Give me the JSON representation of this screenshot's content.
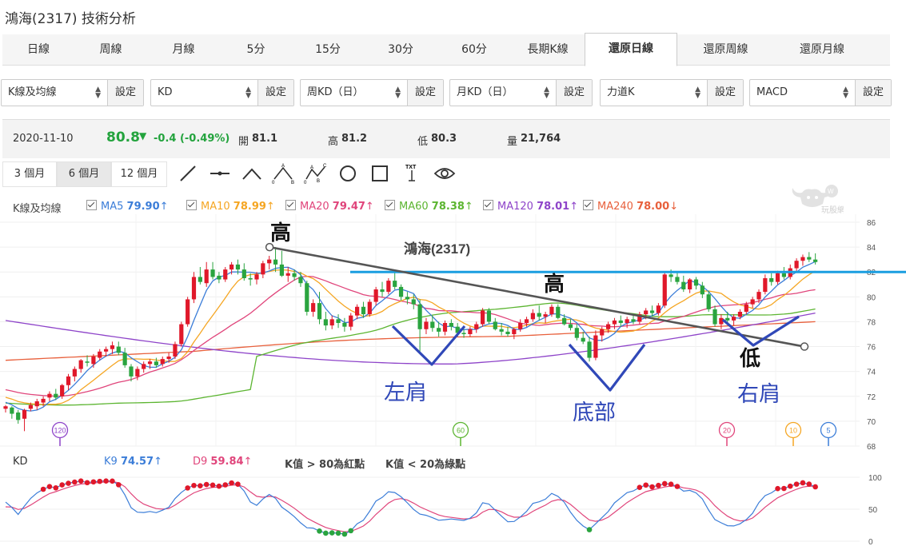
{
  "page": {
    "title": "鴻海(2317) 技術分析"
  },
  "tabs": [
    "日線",
    "周線",
    "月線",
    "5分",
    "15分",
    "30分",
    "60分",
    "長期K線",
    "還原日線",
    "還原周線",
    "還原月線"
  ],
  "active_tab": "還原日線",
  "selectors": [
    {
      "value": "K線及均線",
      "button": "設定"
    },
    {
      "value": "KD",
      "button": "設定"
    },
    {
      "value": "周KD（日）",
      "button": "設定"
    },
    {
      "value": "月KD（日）",
      "button": "設定"
    },
    {
      "value": "力道K",
      "button": "設定"
    },
    {
      "value": "MACD",
      "button": "設定"
    }
  ],
  "quote": {
    "date": "2020-11-10",
    "price": "80.8",
    "change": "-0.4 (-0.49%)",
    "open_label": "開",
    "open": "81.1",
    "high_label": "高",
    "high": "81.2",
    "low_label": "低",
    "low": "80.3",
    "volume_label": "量",
    "volume": "21,764"
  },
  "ranges": [
    "3 個月",
    "6 個月",
    "12 個月"
  ],
  "active_range": "6 個月",
  "tools": [
    "line-tool-icon",
    "horizontal-line-tool-icon",
    "angle-tool-icon",
    "abc-pattern-tool-icon",
    "abcd-pattern-tool-icon",
    "circle-tool-icon",
    "rectangle-tool-icon",
    "text-tool-icon",
    "eye-icon"
  ],
  "tool_text": {
    "abc_a": "A",
    "abc_b": "B",
    "abc_c": "C",
    "abc_o": "0",
    "abcd_a": "A",
    "abcd_b": "B",
    "abcd_c": "C",
    "abcd_d": "D",
    "abcd_o": "0",
    "txt": "TXT"
  },
  "ma_legend": {
    "title": "K線及均線",
    "items": [
      {
        "label": "MA5",
        "value": "79.90",
        "arrow": "↑",
        "color": "#3b7dd8"
      },
      {
        "label": "MA10",
        "value": "78.99",
        "arrow": "↑",
        "color": "#f5a623"
      },
      {
        "label": "MA20",
        "value": "79.47",
        "arrow": "↑",
        "color": "#e0457b"
      },
      {
        "label": "MA60",
        "value": "78.38",
        "arrow": "↑",
        "color": "#5cb531"
      },
      {
        "label": "MA120",
        "value": "78.01",
        "arrow": "↑",
        "color": "#8e44c9"
      },
      {
        "label": "MA240",
        "value": "78.00",
        "arrow": "↓",
        "color": "#e8603c"
      }
    ]
  },
  "watermark": "玩股網",
  "kd_legend": {
    "title": "KD",
    "k_label": "K9",
    "k_value": "74.57",
    "k_arrow": "↑",
    "d_label": "D9",
    "d_value": "59.84",
    "d_arrow": "↑",
    "note1": "K值 > 80為紅點",
    "note2": "K值 < 20為綠點"
  },
  "colors": {
    "up": "#e0182a",
    "down": "#2aa43f",
    "ma5": "#3b7dd8",
    "ma10": "#f5a623",
    "ma20": "#e0457b",
    "ma60": "#5cb531",
    "ma120": "#8e44c9",
    "ma240": "#e8603c",
    "annotation": "#3048b8",
    "neckline": "#1a9ee0",
    "trend": "#555555"
  },
  "chart_data": [
    {
      "type": "candlestick",
      "title": "鴻海(2317)",
      "ylim": [
        68,
        86
      ],
      "yticks": [
        "86",
        "84",
        "82",
        "80",
        "78",
        "76",
        "74",
        "72",
        "70",
        "68"
      ],
      "ohlc": [
        [
          71,
          71.3,
          70.7,
          71.2
        ],
        [
          71.1,
          71.2,
          70.2,
          70.6
        ],
        [
          70.7,
          70.9,
          69.8,
          70.1
        ],
        [
          70.2,
          71.0,
          69.2,
          70.9
        ],
        [
          71.0,
          71.5,
          70.8,
          71.3
        ],
        [
          71.2,
          71.8,
          70.9,
          71.6
        ],
        [
          71.5,
          72,
          71.2,
          71.8
        ],
        [
          71.9,
          72.4,
          71.6,
          72.2
        ],
        [
          72.2,
          72.6,
          71.7,
          71.9
        ],
        [
          72,
          73,
          71.8,
          72.9
        ],
        [
          72.9,
          73.8,
          72.5,
          73.6
        ],
        [
          73.6,
          74.4,
          73.2,
          74.2
        ],
        [
          74.2,
          75,
          73.9,
          74.9
        ],
        [
          74.8,
          75.3,
          74.4,
          74.7
        ],
        [
          74.6,
          75.4,
          74.3,
          75.2
        ],
        [
          75.1,
          75.8,
          74.9,
          75.6
        ],
        [
          75.6,
          76,
          75.2,
          75.8
        ],
        [
          75.8,
          76.4,
          75.4,
          76.1
        ],
        [
          76,
          76.4,
          75.3,
          75.5
        ],
        [
          75.5,
          75.9,
          74.3,
          74.5
        ],
        [
          74.4,
          74.6,
          73.2,
          73.6
        ],
        [
          73.6,
          74.4,
          73.3,
          74.2
        ],
        [
          74.2,
          74.8,
          73.9,
          74.6
        ],
        [
          74.6,
          75,
          74.2,
          74.8
        ],
        [
          74.8,
          75.1,
          74.3,
          74.5
        ],
        [
          74.6,
          75.2,
          74.4,
          75
        ],
        [
          75,
          75.5,
          74.7,
          75.2
        ],
        [
          75.2,
          76.4,
          75,
          76.2
        ],
        [
          76.2,
          78,
          76,
          77.8
        ],
        [
          77.8,
          80,
          77.6,
          79.8
        ],
        [
          79.8,
          82,
          79.5,
          81.6
        ],
        [
          81.6,
          82.4,
          81,
          81.2
        ],
        [
          81.1,
          82.8,
          80.8,
          82.2
        ],
        [
          82.2,
          82.8,
          81.4,
          81.6
        ],
        [
          81.7,
          82,
          81.1,
          81.4
        ],
        [
          81.4,
          82.4,
          81.2,
          82.2
        ],
        [
          82.2,
          82.8,
          81.8,
          82.6
        ],
        [
          82.6,
          83,
          81.8,
          82.2
        ],
        [
          82.2,
          82.7,
          81.3,
          81.5
        ],
        [
          81.5,
          81.9,
          80.9,
          81.4
        ],
        [
          81.4,
          82,
          81,
          81.8
        ],
        [
          81.8,
          82.9,
          81.5,
          82.7
        ],
        [
          82.7,
          83.3,
          82.2,
          83
        ],
        [
          83,
          84,
          82,
          82.6
        ],
        [
          82.6,
          83.7,
          81.6,
          81.7
        ],
        [
          81.7,
          82.4,
          81.2,
          81.9
        ],
        [
          81.9,
          82.2,
          81.3,
          81.6
        ],
        [
          81.6,
          82,
          80.8,
          81.1
        ],
        [
          81.1,
          81.3,
          78.5,
          78.8
        ],
        [
          78.8,
          79.8,
          78.4,
          79.5
        ],
        [
          79.5,
          80.4,
          77.8,
          78.2
        ],
        [
          78.2,
          78.8,
          77.3,
          77.7
        ],
        [
          77.7,
          78.5,
          77.4,
          78.2
        ],
        [
          78.2,
          78.6,
          77.5,
          77.9
        ],
        [
          77.9,
          78.3,
          77.2,
          77.6
        ],
        [
          77.6,
          78.7,
          77.3,
          78.5
        ],
        [
          78.5,
          79.4,
          78.2,
          79.2
        ],
        [
          79.2,
          79.6,
          78.3,
          78.6
        ],
        [
          78.6,
          79.8,
          78.4,
          79.6
        ],
        [
          79.6,
          80.8,
          79.3,
          80.6
        ],
        [
          80.6,
          81.2,
          80,
          80.4
        ],
        [
          80.4,
          81.5,
          80.2,
          81.3
        ],
        [
          81.3,
          82.1,
          80.6,
          80.8
        ],
        [
          80.8,
          81,
          79.7,
          80
        ],
        [
          80,
          80.4,
          79.4,
          79.8
        ],
        [
          79.8,
          80.2,
          79,
          79.4
        ],
        [
          79.4,
          79.8,
          75.6,
          77.4
        ],
        [
          77.4,
          78.3,
          77,
          78
        ],
        [
          78,
          78.5,
          77.2,
          77.5
        ],
        [
          77.5,
          78,
          76.8,
          77.2
        ],
        [
          77.2,
          78.1,
          76.9,
          77.9
        ],
        [
          77.9,
          78.2,
          77.3,
          77.6
        ],
        [
          77.6,
          77.9,
          76.8,
          77.1
        ],
        [
          77.1,
          77.4,
          76.7,
          77
        ],
        [
          77,
          77.6,
          76.8,
          77.4
        ],
        [
          77.4,
          78,
          77.1,
          77.8
        ],
        [
          77.8,
          79.1,
          77.6,
          78.9
        ],
        [
          78.9,
          79.1,
          77.8,
          78
        ],
        [
          78,
          78.3,
          77.3,
          77.4
        ],
        [
          77.4,
          77.9,
          76.9,
          77.2
        ],
        [
          77.2,
          77.6,
          76.8,
          77
        ],
        [
          77,
          77.5,
          76.6,
          77.4
        ],
        [
          77.4,
          78.2,
          77.2,
          77.9
        ],
        [
          77.9,
          78.4,
          77.6,
          78.2
        ],
        [
          78.2,
          79,
          78,
          78.7
        ],
        [
          78.7,
          79.3,
          78.1,
          78.4
        ],
        [
          78.4,
          78.8,
          77.9,
          78.6
        ],
        [
          78.6,
          79.4,
          78.4,
          79.2
        ],
        [
          79.2,
          79.4,
          78.2,
          78.3
        ],
        [
          78.3,
          78.6,
          77.7,
          77.8
        ],
        [
          77.8,
          78.2,
          77.3,
          77.5
        ],
        [
          77.5,
          77.8,
          76.5,
          76.7
        ],
        [
          76.7,
          77.2,
          76.2,
          76.4
        ],
        [
          76.4,
          76.8,
          74.8,
          75.1
        ],
        [
          75.1,
          77.3,
          74.9,
          76.9
        ],
        [
          76.9,
          77.6,
          76.4,
          77.4
        ],
        [
          77.4,
          78,
          77.1,
          77.8
        ],
        [
          77.8,
          78.3,
          77.4,
          78.1
        ],
        [
          78.1,
          78.5,
          77.6,
          77.9
        ],
        [
          77.9,
          78.4,
          77.5,
          78.2
        ],
        [
          78.2,
          78.6,
          77.8,
          78
        ],
        [
          78,
          78.8,
          77.8,
          78.6
        ],
        [
          78.6,
          79.1,
          78.2,
          78.9
        ],
        [
          78.9,
          79.3,
          78.4,
          78.7
        ],
        [
          78.7,
          79.5,
          78.5,
          79.3
        ],
        [
          79.3,
          82,
          79.1,
          81.8
        ],
        [
          81.8,
          82.2,
          81.2,
          81.6
        ],
        [
          81.6,
          82,
          81,
          81.2
        ],
        [
          81.2,
          81.7,
          80.4,
          80.6
        ],
        [
          80.6,
          81.5,
          80.3,
          81.4
        ],
        [
          81.4,
          81.6,
          80.6,
          80.9
        ],
        [
          80.9,
          81.2,
          79.9,
          80.2
        ],
        [
          80.2,
          80.5,
          78.8,
          79
        ],
        [
          79,
          79.3,
          77.6,
          77.8
        ],
        [
          77.8,
          78.6,
          77.4,
          78.3
        ],
        [
          78.3,
          78.8,
          77.8,
          78.1
        ],
        [
          78.1,
          78.6,
          77.7,
          78.4
        ],
        [
          78.4,
          79,
          78.2,
          78.8
        ],
        [
          78.8,
          79.6,
          78.6,
          79.4
        ],
        [
          79.4,
          80,
          79.1,
          79.8
        ],
        [
          79.8,
          80.6,
          79.5,
          80.4
        ],
        [
          80.4,
          81.8,
          80.2,
          81.5
        ],
        [
          81.5,
          81.9,
          80.9,
          81.2
        ],
        [
          81.2,
          82.1,
          81,
          81.9
        ],
        [
          81.9,
          82.4,
          81.4,
          81.6
        ],
        [
          81.6,
          82.6,
          81.4,
          82.3
        ],
        [
          82.3,
          83.1,
          82,
          82.9
        ],
        [
          82.9,
          83.4,
          82.5,
          83.2
        ],
        [
          83.2,
          83.6,
          82.8,
          83
        ],
        [
          83,
          83.5,
          82.6,
          82.8
        ],
        [
          81.1,
          81.2,
          80.3,
          80.8
        ]
      ],
      "ma_markers": [
        "120",
        "60",
        "20",
        "10",
        "5"
      ],
      "annotations": {
        "high_left": "高",
        "high_mid": "高",
        "low_right": "低",
        "left_shoulder": "左肩",
        "head": "底部",
        "right_shoulder": "右肩",
        "trendline_start": [
          82.6,
          84
        ],
        "trendline_end": [
          137,
          76.0
        ],
        "neckline_level": 82.0
      }
    },
    {
      "type": "line",
      "title": "KD",
      "ylim": [
        0,
        100
      ],
      "yticks": [
        "100",
        "50",
        "0"
      ],
      "series": [
        {
          "name": "K9"
        },
        {
          "name": "D9"
        }
      ]
    }
  ]
}
